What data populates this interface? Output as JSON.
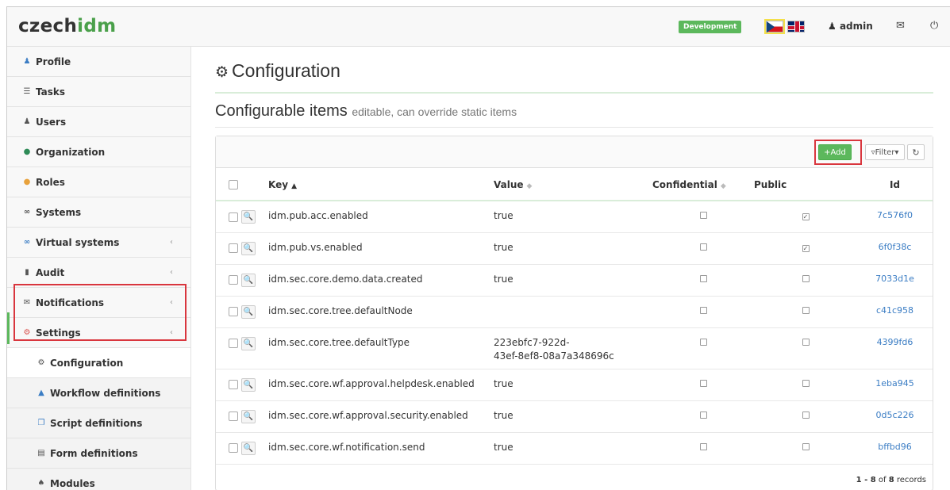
{
  "header": {
    "logo_prefix": "czech",
    "logo_suffix": "idm",
    "environment": "Development",
    "user": "admin",
    "user_icon": "user-icon",
    "mail_icon": "envelope-icon",
    "logout_icon": "power-icon"
  },
  "sidebar": {
    "items": [
      {
        "label": "Profile",
        "icon": "user-icon"
      },
      {
        "label": "Tasks",
        "icon": "tasks-icon"
      },
      {
        "label": "Users",
        "icon": "users-icon"
      },
      {
        "label": "Organization",
        "icon": "tree-icon"
      },
      {
        "label": "Roles",
        "icon": "roles-icon"
      },
      {
        "label": "Systems",
        "icon": "link-icon"
      },
      {
        "label": "Virtual systems",
        "icon": "link-icon"
      },
      {
        "label": "Audit",
        "icon": "chart-icon"
      },
      {
        "label": "Notifications",
        "icon": "envelope-icon"
      },
      {
        "label": "Settings",
        "icon": "cog-icon"
      },
      {
        "label": "Configuration",
        "icon": "cog-icon"
      },
      {
        "label": "Workflow definitions",
        "icon": "sitemap-icon"
      },
      {
        "label": "Script definitions",
        "icon": "copy-icon"
      },
      {
        "label": "Form definitions",
        "icon": "list-icon"
      },
      {
        "label": "Modules",
        "icon": "puzzle-icon"
      }
    ]
  },
  "main": {
    "title": "Configuration",
    "section_title": "Configurable items",
    "section_subtitle": "editable, can override static items",
    "toolbar": {
      "add_label": "Add",
      "filter_label": "Filter"
    },
    "columns": {
      "key": "Key",
      "value": "Value",
      "confidential": "Confidential",
      "public": "Public",
      "id": "Id"
    },
    "rows": [
      {
        "key": "idm.pub.acc.enabled",
        "value": "true",
        "confidential": false,
        "public": true,
        "id": "7c576f0"
      },
      {
        "key": "idm.pub.vs.enabled",
        "value": "true",
        "confidential": false,
        "public": true,
        "id": "6f0f38c"
      },
      {
        "key": "idm.sec.core.demo.data.created",
        "value": "true",
        "confidential": false,
        "public": false,
        "id": "7033d1e"
      },
      {
        "key": "idm.sec.core.tree.defaultNode",
        "value": "",
        "confidential": false,
        "public": false,
        "id": "c41c958"
      },
      {
        "key": "idm.sec.core.tree.defaultType",
        "value": "223ebfc7-922d-",
        "value2": "43ef-8ef8-08a7a348696c",
        "confidential": false,
        "public": false,
        "id": "4399fd6"
      },
      {
        "key": "idm.sec.core.wf.approval.helpdesk.enabled",
        "value": "true",
        "confidential": false,
        "public": false,
        "id": "1eba945"
      },
      {
        "key": "idm.sec.core.wf.approval.security.enabled",
        "value": "true",
        "confidential": false,
        "public": false,
        "id": "0d5c226"
      },
      {
        "key": "idm.sec.core.wf.notification.send",
        "value": "true",
        "confidential": false,
        "public": false,
        "id": "bffbd96"
      }
    ],
    "records_range": "1 - 8",
    "records_of": "of",
    "records_total": "8",
    "records_suffix": "records"
  }
}
